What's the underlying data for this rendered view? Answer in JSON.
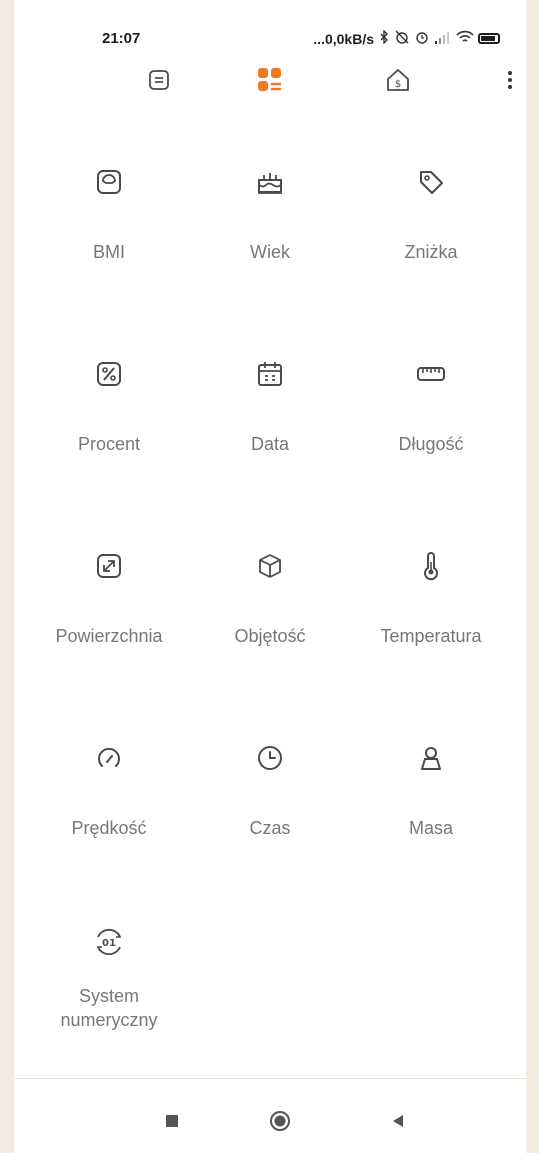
{
  "status_bar": {
    "time": "21:07",
    "net_speed": "...0,0kB/s",
    "icons": [
      "bluetooth-icon",
      "alarm-off-icon",
      "alarm-icon",
      "signal-icon",
      "wifi-icon",
      "battery-icon"
    ]
  },
  "toolbar": {
    "buttons": [
      "calculator-icon",
      "converters-icon",
      "currency-icon",
      "more-menu-icon"
    ],
    "active": "converters-icon",
    "accent": "#f07a24"
  },
  "converters": [
    {
      "label": "BMI",
      "icon": "scale-icon"
    },
    {
      "label": "Wiek",
      "icon": "cake-icon"
    },
    {
      "label": "Zniżka",
      "icon": "tag-icon"
    },
    {
      "label": "Procent",
      "icon": "percent-icon"
    },
    {
      "label": "Data",
      "icon": "calendar-icon"
    },
    {
      "label": "Długość",
      "icon": "ruler-icon"
    },
    {
      "label": "Powierzchnia",
      "icon": "area-icon"
    },
    {
      "label": "Objętość",
      "icon": "volume-icon"
    },
    {
      "label": "Temperatura",
      "icon": "thermometer-icon"
    },
    {
      "label": "Prędkość",
      "icon": "speedometer-icon"
    },
    {
      "label": "Czas",
      "icon": "clock-icon"
    },
    {
      "label": "Masa",
      "icon": "weight-icon"
    },
    {
      "label": "System numeryczny",
      "icon": "number-system-icon"
    }
  ],
  "nav_bar": {
    "buttons": [
      "recents-square-icon",
      "home-circle-icon",
      "back-triangle-icon"
    ]
  },
  "colors": {
    "icon": "#4a4a4a",
    "label": "#777777",
    "background": "#ffffff"
  }
}
